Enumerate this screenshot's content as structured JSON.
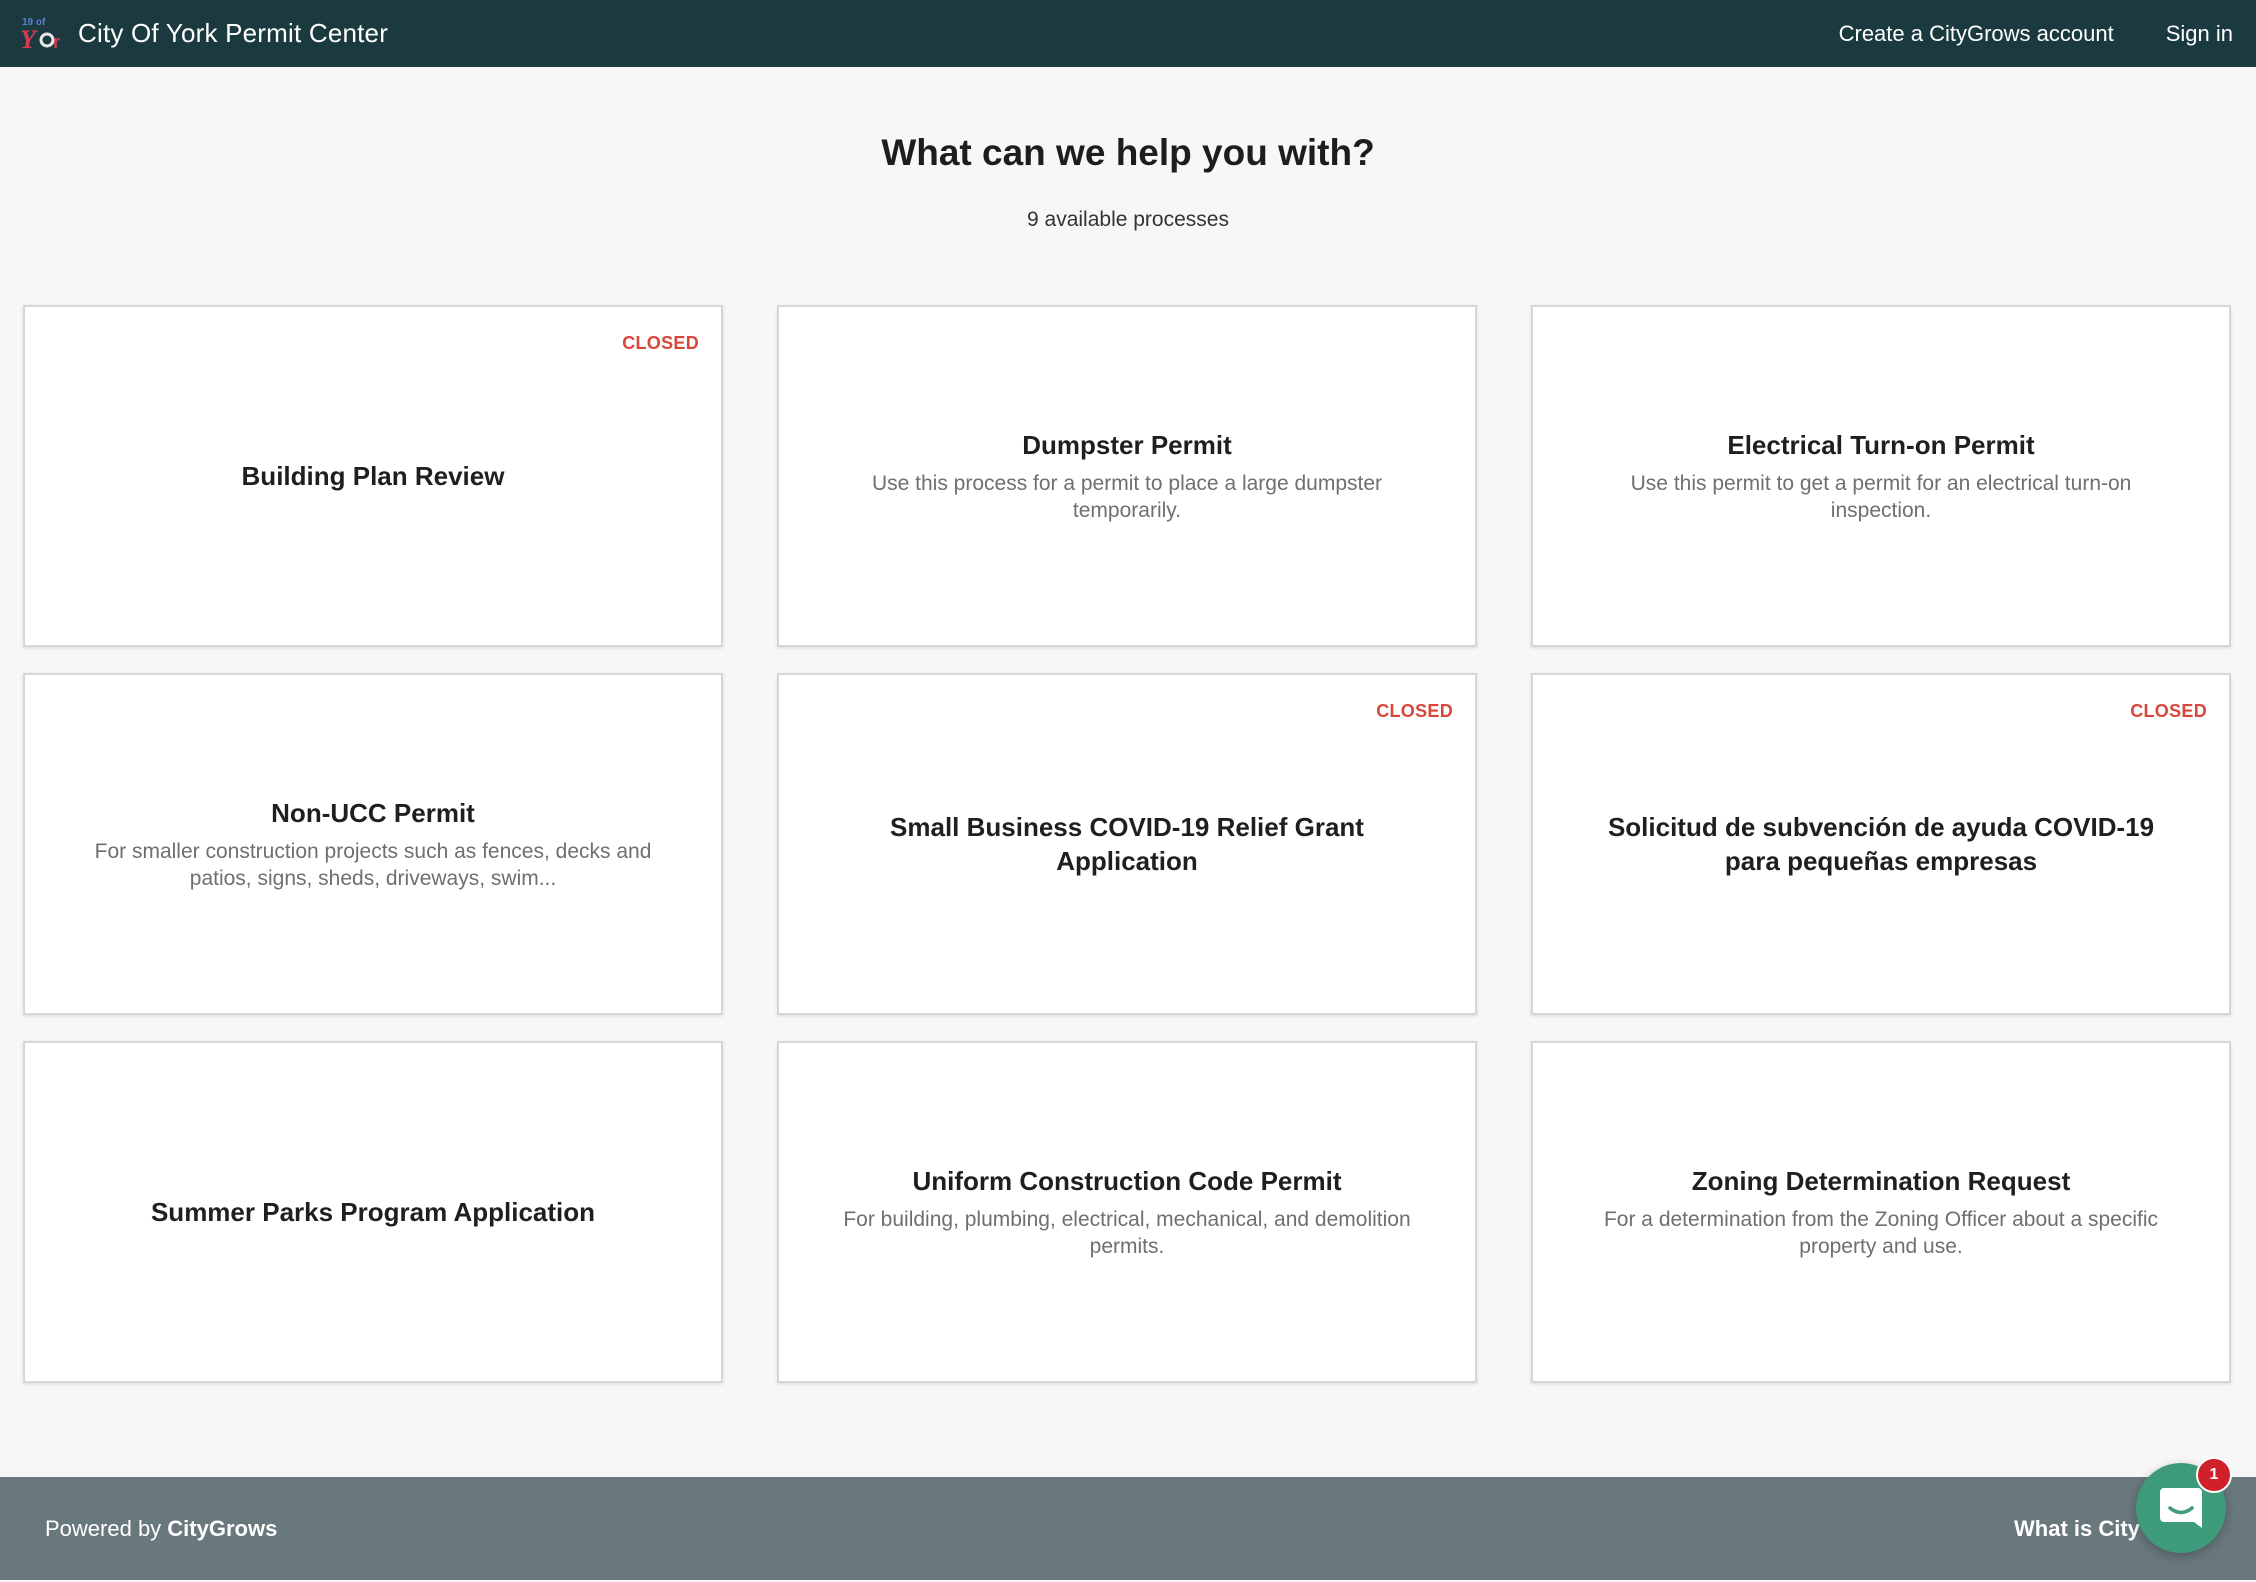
{
  "header": {
    "title": "City Of York Permit Center",
    "create_account_label": "Create a CityGrows account",
    "sign_in_label": "Sign in"
  },
  "main": {
    "heading": "What can we help you with?",
    "count_text": "9 available processes",
    "cards": [
      {
        "title": "Building Plan Review",
        "description": "",
        "status": "CLOSED"
      },
      {
        "title": "Dumpster Permit",
        "description": "Use this process for a permit to place a large dumpster temporarily.",
        "status": ""
      },
      {
        "title": "Electrical Turn-on Permit",
        "description": "Use this permit to get a permit for an electrical turn-on inspection.",
        "status": ""
      },
      {
        "title": "Non-UCC Permit",
        "description": "For smaller construction projects such as fences, decks and patios, signs, sheds, driveways, swim...",
        "status": ""
      },
      {
        "title": "Small Business COVID-19 Relief Grant Application",
        "description": "",
        "status": "CLOSED"
      },
      {
        "title": "Solicitud de subvención de ayuda COVID-19 para pequeñas empresas",
        "description": "",
        "status": "CLOSED"
      },
      {
        "title": "Summer Parks Program Application",
        "description": "",
        "status": ""
      },
      {
        "title": "Uniform Construction Code Permit",
        "description": "For building, plumbing, electrical, mechanical, and demolition permits.",
        "status": ""
      },
      {
        "title": "Zoning Determination Request",
        "description": "For a determination from the Zoning Officer about a specific property and use.",
        "status": ""
      }
    ]
  },
  "footer": {
    "powered_prefix": "Powered by ",
    "powered_brand": "CityGrows",
    "what_is_label": "What is City"
  },
  "chat": {
    "unread_count": "1"
  },
  "colors": {
    "header_bg": "#1b3a3f",
    "footer_bg": "#68787c",
    "closed_badge": "#d9463a",
    "chat_green": "#3d9b7c",
    "chat_badge": "#d0202a"
  },
  "icons": {
    "logo": "york-city-logo",
    "chat": "chat-bubble-icon"
  }
}
